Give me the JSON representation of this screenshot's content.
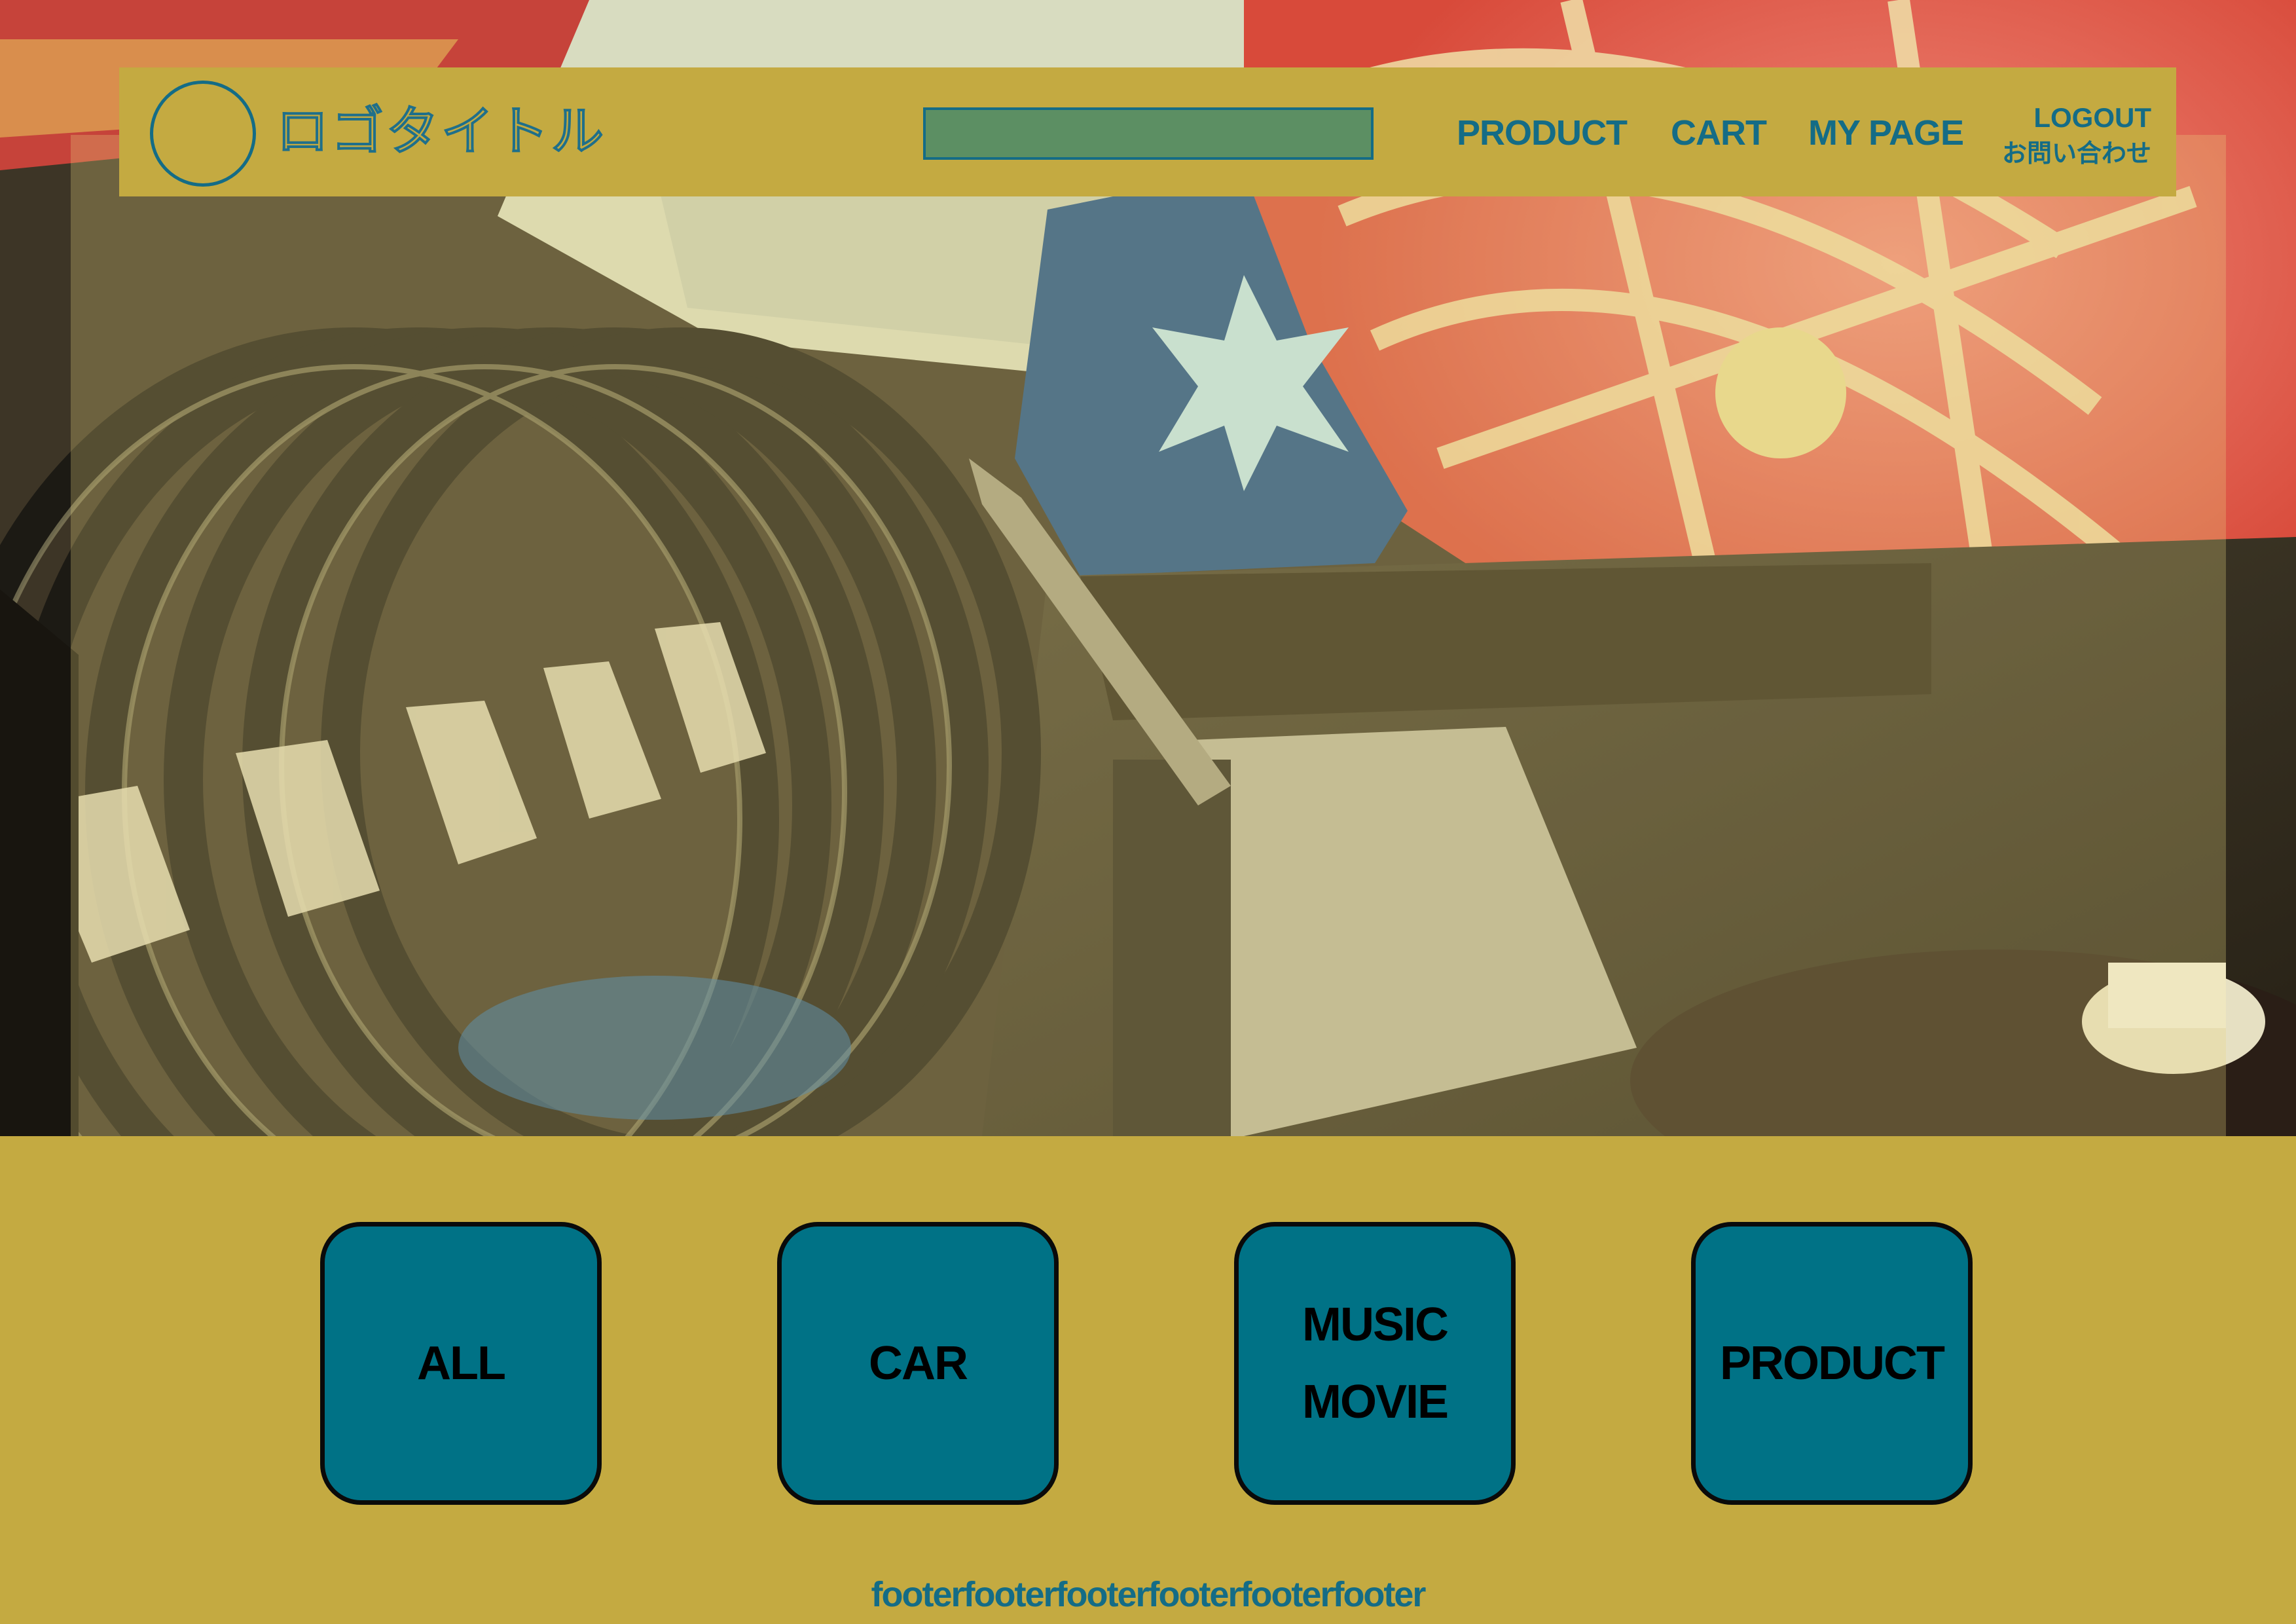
{
  "header": {
    "logo_title": "ロゴタイトル",
    "search": {
      "value": "",
      "placeholder": ""
    },
    "nav": {
      "product": "PRODUCT",
      "cart": "CART",
      "my_page": "MY PAGE",
      "logout": "LOGOUT",
      "contact": "お問い合わせ"
    }
  },
  "categories": {
    "all": "ALL",
    "car": "CAR",
    "music": "MUSIC",
    "movie": "MOVIE",
    "product": "PRODUCT"
  },
  "footer": {
    "text": "footerfooterfooterfooterfooterfooter"
  },
  "colors": {
    "gold": "#c4aa41",
    "teal": "#007286",
    "text_teal": "#146c86",
    "search_green": "#5c8f63"
  }
}
